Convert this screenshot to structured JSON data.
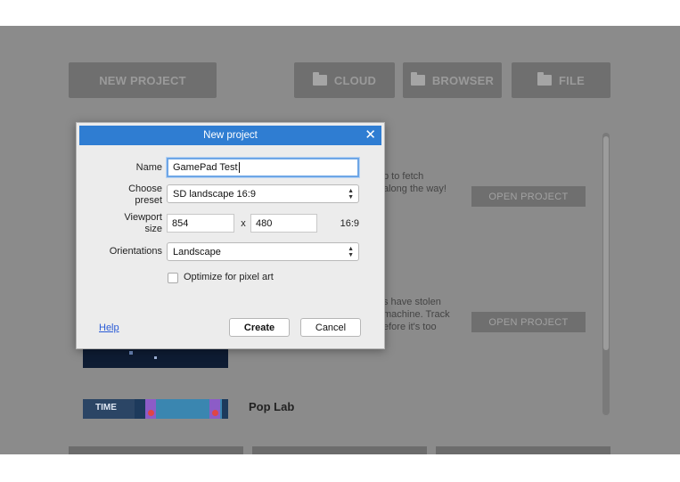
{
  "background": {
    "top_buttons": {
      "new_project": "NEW PROJECT",
      "cloud": "CLOUD",
      "browser": "BROWSER",
      "file": "FILE"
    },
    "project1": {
      "desc_lines": [
        "p to fetch",
        "along the way!"
      ],
      "open_label": "OPEN PROJECT"
    },
    "project2": {
      "desc_lines": [
        "s have stolen",
        "machine. Track",
        "efore it's too"
      ],
      "open_label": "OPEN PROJECT"
    },
    "project3": {
      "name": "Pop Lab",
      "thumb_text": "TIME"
    }
  },
  "dialog": {
    "title": "New project",
    "name_label": "Name",
    "name_value": "GamePad Test",
    "preset_label_1": "Choose",
    "preset_label_2": "preset",
    "preset_value": "SD landscape 16:9",
    "viewport_label_1": "Viewport",
    "viewport_label_2": "size",
    "viewport_width": "854",
    "viewport_sep": "x",
    "viewport_height": "480",
    "aspect_ratio": "16:9",
    "orientations_label": "Orientations",
    "orientations_value": "Landscape",
    "pixel_art_label": "Optimize for pixel art",
    "help_label": "Help",
    "create_label": "Create",
    "cancel_label": "Cancel"
  },
  "colors": {
    "titlebar": "#2f7dd2",
    "overlay": "#8b8b8b",
    "help_link": "#2a5bd6"
  }
}
